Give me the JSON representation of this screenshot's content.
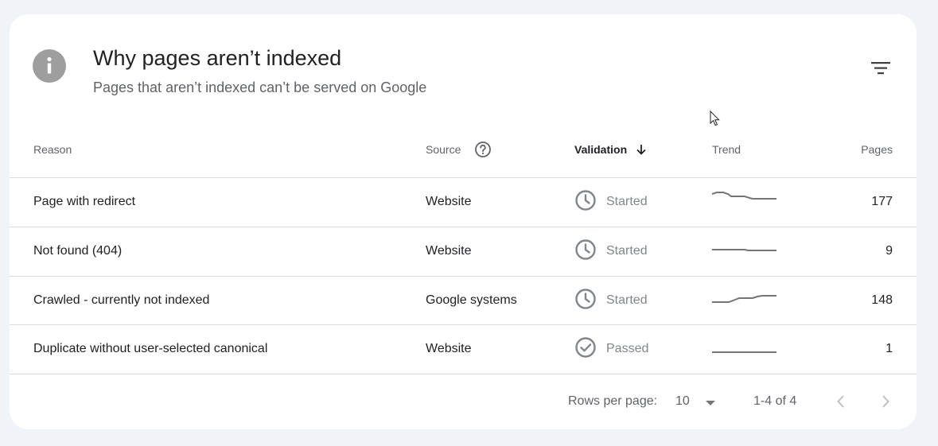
{
  "header": {
    "icon": "info-icon",
    "title": "Why pages aren’t indexed",
    "subtitle": "Pages that aren’t indexed can’t be served on Google",
    "filter_icon": "filter-icon"
  },
  "table": {
    "columns": {
      "reason": "Reason",
      "source": "Source",
      "validation": "Validation",
      "trend": "Trend",
      "pages": "Pages"
    },
    "rows": [
      {
        "reason": "Page with redirect",
        "source": "Website",
        "status": "Started",
        "status_icon": "clock-icon",
        "pages": "177"
      },
      {
        "reason": "Not found (404)",
        "source": "Website",
        "status": "Started",
        "status_icon": "clock-icon",
        "pages": "9"
      },
      {
        "reason": "Crawled - currently not indexed",
        "source": "Google systems",
        "status": "Started",
        "status_icon": "clock-icon",
        "pages": "148"
      },
      {
        "reason": "Duplicate without user-selected canonical",
        "source": "Website",
        "status": "Passed",
        "status_icon": "check-circle-icon",
        "pages": "1"
      }
    ]
  },
  "footer": {
    "rows_per_page_label": "Rows per page:",
    "rows_per_page_value": "10",
    "range": "1-4 of 4"
  },
  "colors": {
    "background": "#f0f4f9",
    "card": "#ffffff",
    "icon_gray": "#9e9e9e",
    "muted_text": "#5f6368",
    "divider": "#dadce0"
  }
}
